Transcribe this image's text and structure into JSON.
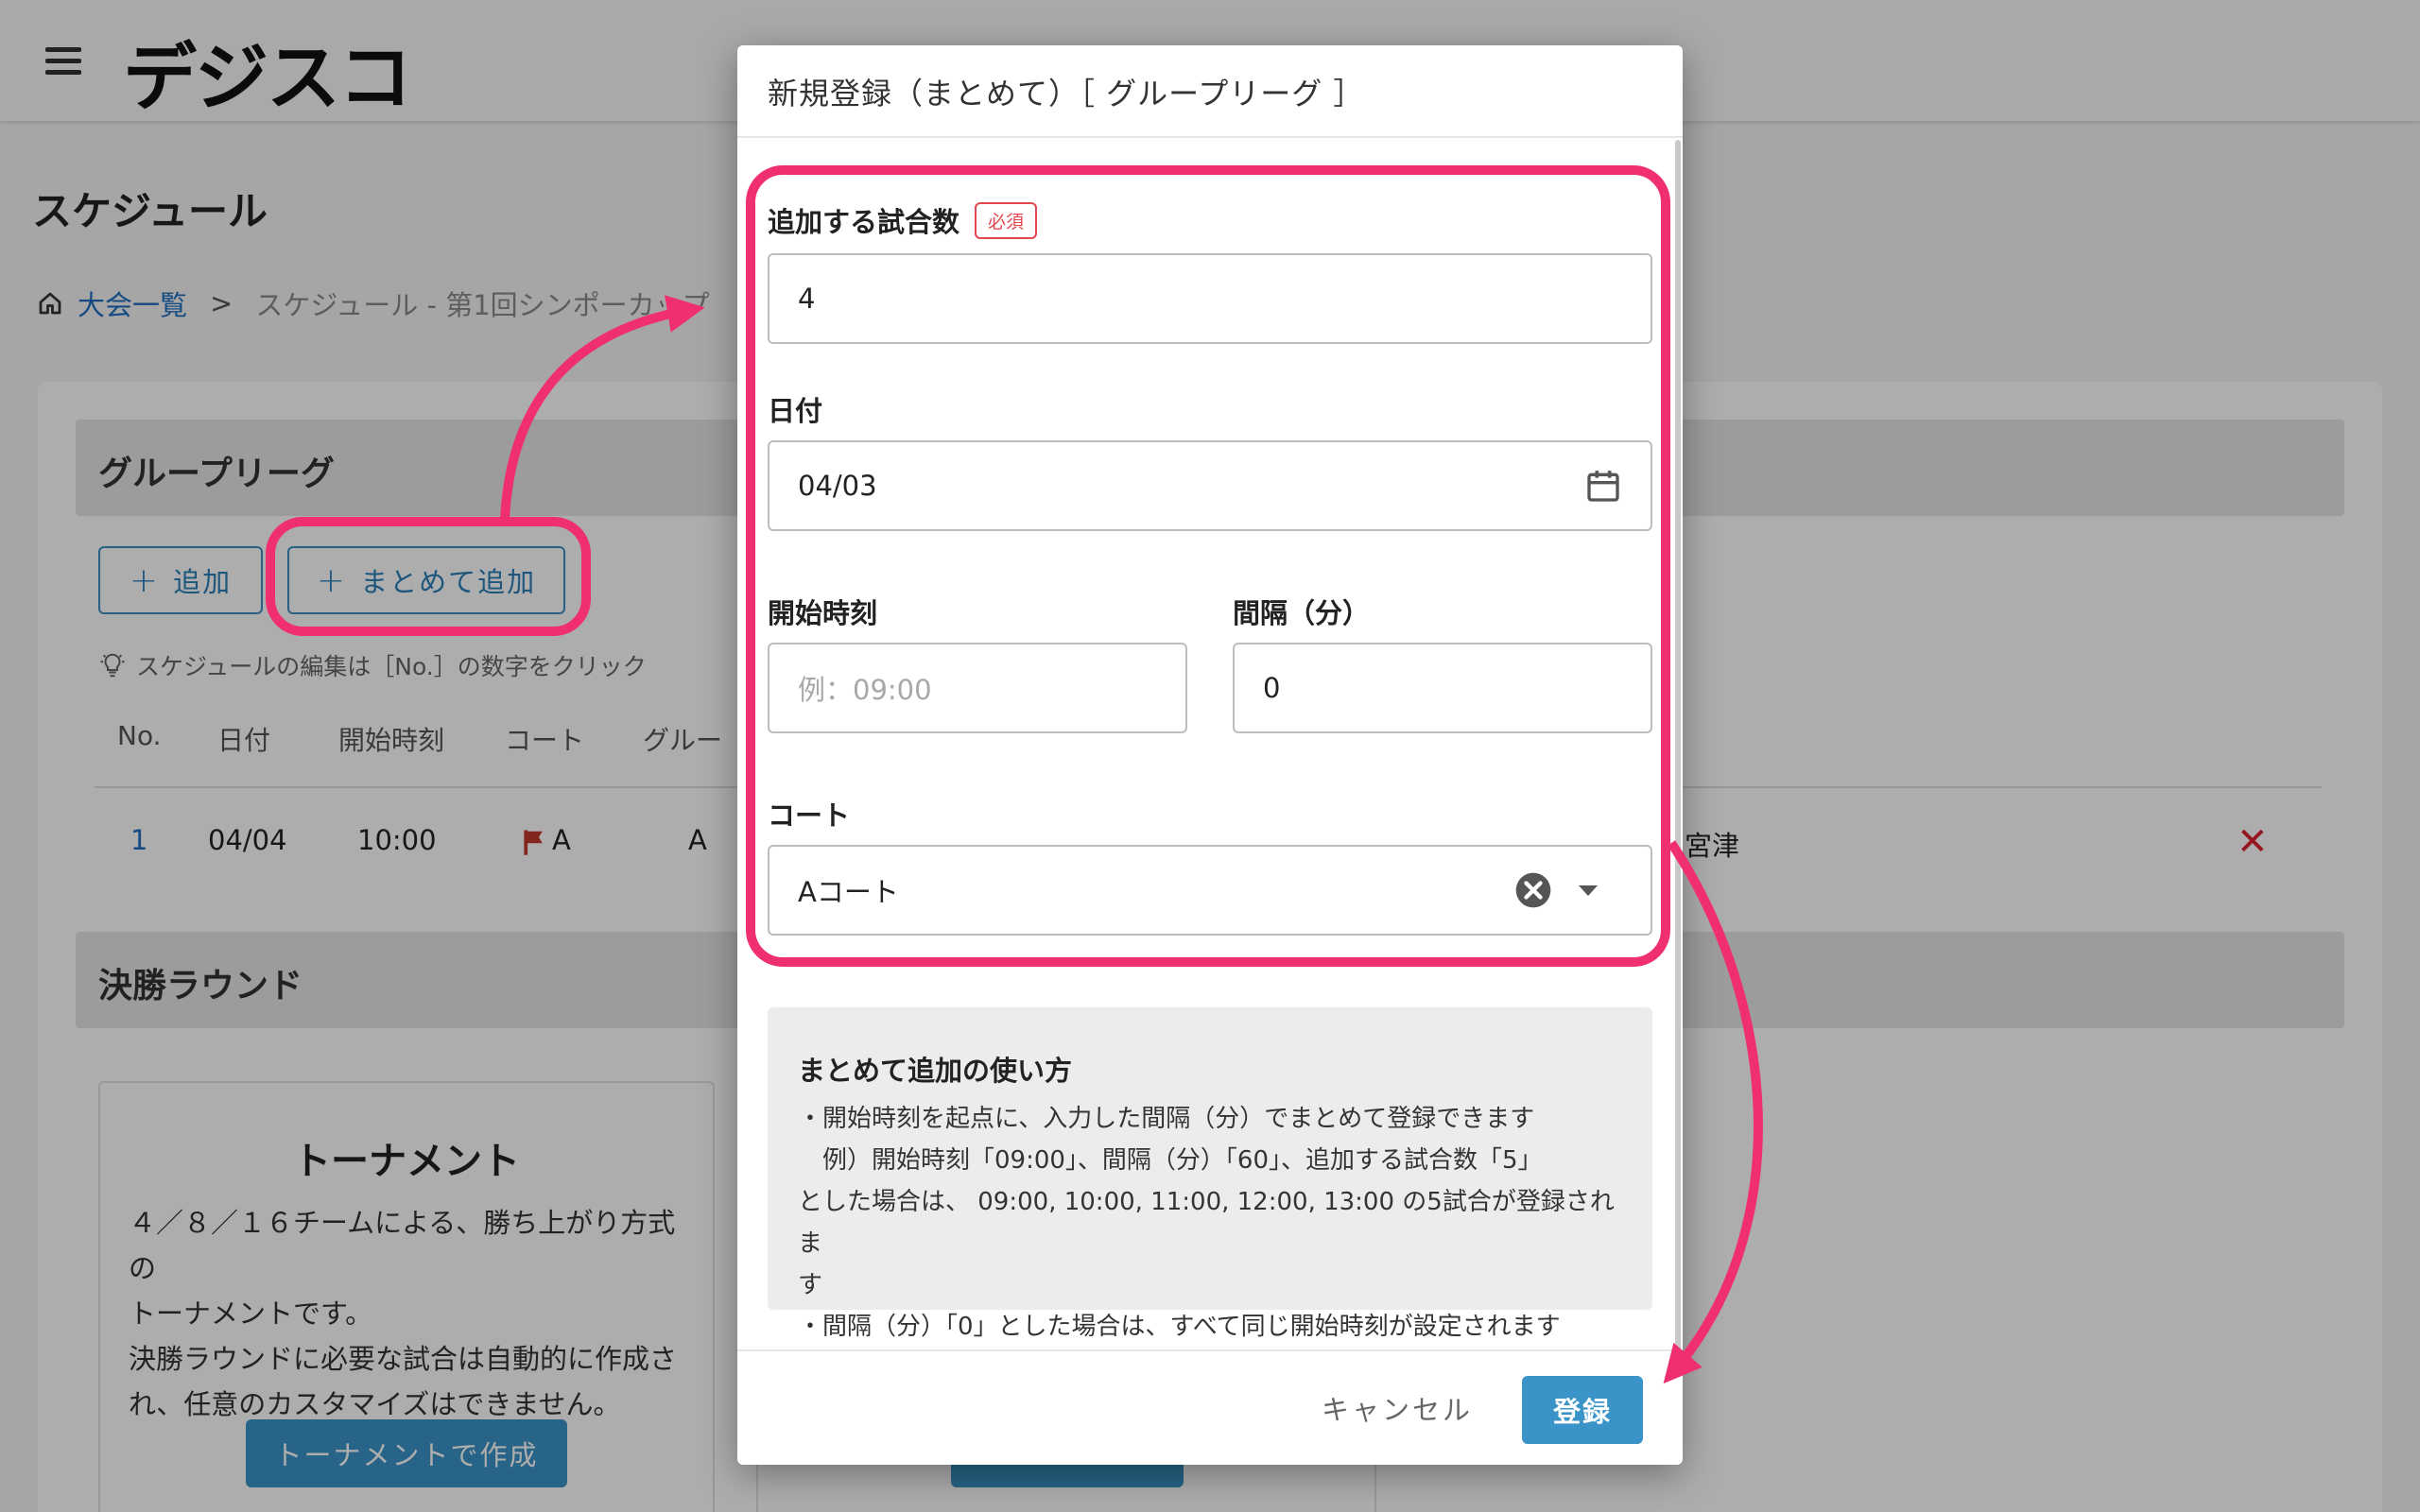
{
  "header": {
    "logo": "デジスコ",
    "menu_icon": "hamburger-menu-icon"
  },
  "page": {
    "title": "スケジュール"
  },
  "breadcrumb": {
    "home": "大会一覧",
    "separator": ">",
    "current": "スケジュール - 第1回シンポーカップ"
  },
  "group_section": {
    "title": "グループリーグ",
    "add_label": "追加",
    "bulk_add_label": "まとめて追加",
    "hint": "スケジュールの編集は［No.］の数字をクリック",
    "columns": [
      "No.",
      "日付",
      "開始時刻",
      "コート",
      "グルー"
    ],
    "row": {
      "no": "1",
      "date": "04/04",
      "time": "10:00",
      "court": "A",
      "group": "A",
      "team": "宮津"
    }
  },
  "final_section": {
    "title": "決勝ラウンド",
    "tournament_card": {
      "title": "トーナメント",
      "desc": [
        "４／８／１６チームによる、勝ち上がり方式の",
        "トーナメントです。",
        "決勝ラウンドに必要な試合は自動的に作成さ",
        "れ、任意のカスタマイズはできません。"
      ],
      "button": "トーナメントで作成"
    }
  },
  "modal": {
    "title": "新規登録（まとめて）［ グループリーグ ］",
    "match_count": {
      "label": "追加する試合数",
      "required": "必須",
      "value": "4"
    },
    "date": {
      "label": "日付",
      "value": "04/03"
    },
    "start_time": {
      "label": "開始時刻",
      "placeholder": "例：09:00"
    },
    "interval": {
      "label": "間隔（分）",
      "value": "0"
    },
    "court": {
      "label": "コート",
      "value": "Aコート"
    },
    "help": {
      "title": "まとめて追加の使い方",
      "lines": [
        "・開始時刻を起点に、入力した間隔（分）でまとめて登録できます",
        "　例）開始時刻「09:00」、間隔（分）「60」、追加する試合数「5」",
        "とした場合は、 09:00, 10:00, 11:00, 12:00, 13:00 の5試合が登録されま",
        "す",
        "・間隔（分）「0」とした場合は、すべて同じ開始時刻が設定されます"
      ]
    },
    "cancel": "キャンセル",
    "submit": "登録"
  },
  "colors": {
    "accent": "#3a94c8",
    "annotation": "#f0306e",
    "required": "#e2474d"
  }
}
